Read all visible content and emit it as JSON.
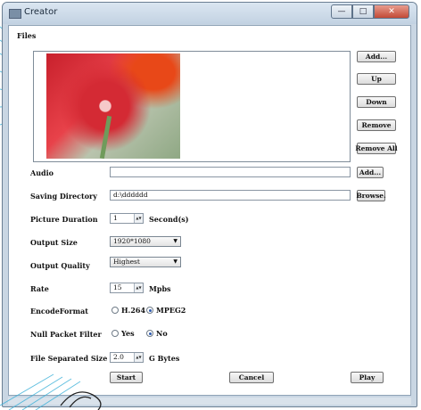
{
  "window": {
    "title": "Creator",
    "minimize_icon": "minimize-icon",
    "maximize_icon": "maximize-icon",
    "close_icon": "close-icon"
  },
  "files": {
    "label": "Files",
    "buttons": {
      "add": "Add...",
      "up": "Up",
      "down": "Down",
      "remove": "Remove",
      "remove_all": "Remove All"
    }
  },
  "audio": {
    "label": "Audio",
    "value": "",
    "button": "Add..."
  },
  "saving_directory": {
    "label": "Saving Directory",
    "value": "d:\\dddddd",
    "button": "Browse."
  },
  "picture_duration": {
    "label": "Picture Duration",
    "value": "1",
    "unit": "Second(s)"
  },
  "output_size": {
    "label": "Output Size",
    "selected": "1920*1080"
  },
  "output_quality": {
    "label": "Output Quality",
    "selected": "Highest"
  },
  "rate": {
    "label": "Rate",
    "value": "15",
    "unit": "Mpbs"
  },
  "encode_format": {
    "label": "EncodeFormat",
    "options": [
      "H.264",
      "MPEG2"
    ],
    "selected": "MPEG2"
  },
  "null_packet_filter": {
    "label": "Null Packet Filter",
    "options": [
      "Yes",
      "No"
    ],
    "selected": "No"
  },
  "file_separated_size": {
    "label": "File Separated Size",
    "value": "2.0",
    "unit": "G Bytes"
  },
  "actions": {
    "start": "Start",
    "cancel": "Cancel",
    "play": "Play"
  },
  "colors": {
    "title_bar": "#c9d6e3",
    "close_button": "#c24a36",
    "radio_selected": "#2f5bb0"
  }
}
